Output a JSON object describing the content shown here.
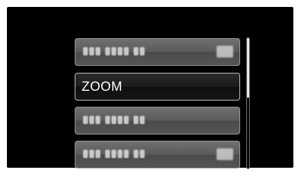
{
  "menu": {
    "items": [
      {
        "label": "",
        "obscured": true,
        "has_icon": true
      },
      {
        "label": "ZOOM",
        "obscured": false,
        "selected": true,
        "has_icon": false
      },
      {
        "label": "",
        "obscured": true,
        "has_icon": false
      },
      {
        "label": "",
        "obscured": true,
        "has_icon": true
      }
    ]
  },
  "scrollbar": {
    "thumb_fraction": 0.46,
    "position_fraction": 0.0
  },
  "colors": {
    "background": "#000000",
    "item_normal": "#5a5a5a",
    "item_selected": "#1c1c1c",
    "text": "#ffffff"
  }
}
